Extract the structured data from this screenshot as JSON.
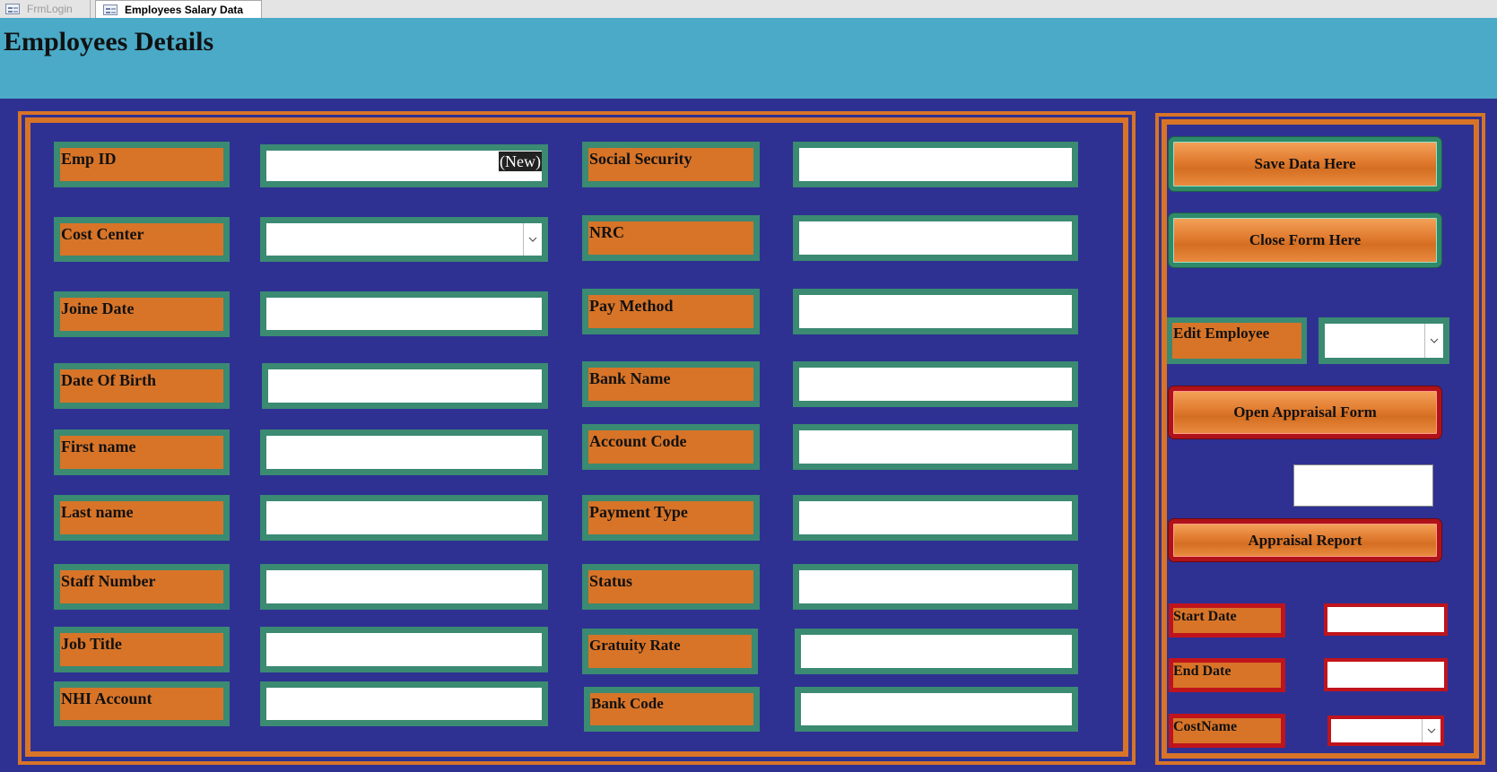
{
  "tabs": [
    {
      "label": "FrmLogin",
      "active": false
    },
    {
      "label": "Employees Salary Data",
      "active": true
    }
  ],
  "page_title": "Employees Details",
  "colors": {
    "background": "#2e3192",
    "header": "#4aaac8",
    "label_fill": "#d87428",
    "label_border": "#3b8a72",
    "frame": "#d87428",
    "alert_border": "#c0141c"
  },
  "form": {
    "emp_id_label": "Emp ID",
    "emp_id_value": "(New)",
    "cost_center_label": "Cost Center",
    "joine_date_label": "Joine Date",
    "date_of_birth_label": "Date Of Birth",
    "first_name_label": "First name",
    "last_name_label": "Last name",
    "staff_number_label": "Staff Number",
    "job_title_label": "Job Title",
    "nhi_account_label": "NHI Account",
    "social_security_label": "Social Security",
    "nrc_label": "NRC",
    "pay_method_label": "Pay Method",
    "bank_name_label": "Bank Name",
    "account_code_label": "Account Code",
    "payment_type_label": "Payment Type",
    "status_label": "Status",
    "gratuity_rate_label": "Gratuity Rate",
    "bank_code_label": "Bank Code"
  },
  "side": {
    "save_label": "Save Data Here",
    "close_label": "Close Form Here",
    "edit_employee_label": "Edit Employee",
    "open_appraisal_label": "Open Appraisal Form",
    "appraisal_report_label": "Appraisal Report",
    "start_date_label": "Start Date",
    "end_date_label": "End Date",
    "cost_name_label": "CostName"
  },
  "icons": {
    "tab_form_icon": "form-icon",
    "dropdown_icon": "chevron-down-icon"
  }
}
